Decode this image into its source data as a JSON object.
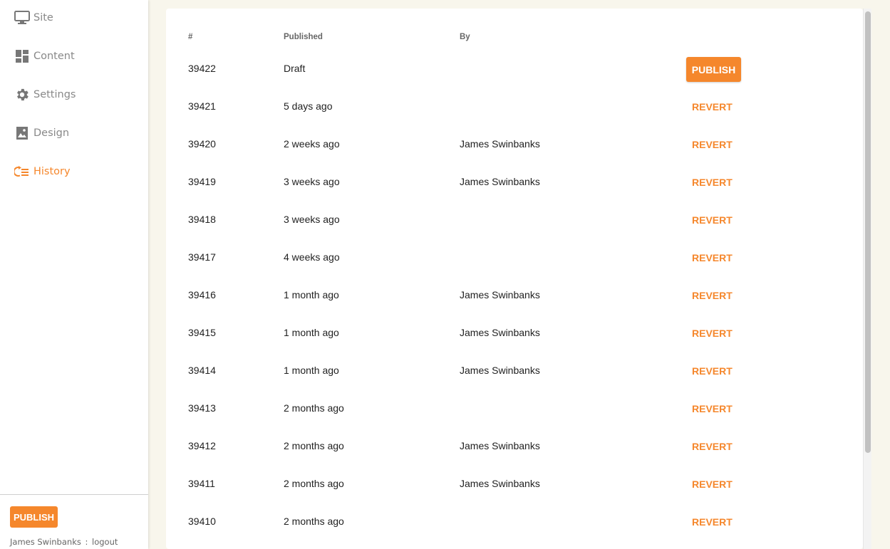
{
  "sidebar": {
    "items": [
      {
        "label": "Site",
        "icon": "monitor-icon",
        "active": false
      },
      {
        "label": "Content",
        "icon": "dashboard-icon",
        "active": false
      },
      {
        "label": "Settings",
        "icon": "gear-icon",
        "active": false
      },
      {
        "label": "Design",
        "icon": "image-icon",
        "active": false
      },
      {
        "label": "History",
        "icon": "history-icon",
        "active": true
      }
    ],
    "publish_label": "PUBLISH",
    "user_name": "James Swinbanks",
    "user_separator": ":",
    "logout_label": "logout"
  },
  "table": {
    "headers": {
      "num": "#",
      "published": "Published",
      "by": "By"
    },
    "rows": [
      {
        "num": "39422",
        "published": "Draft",
        "by": "",
        "action": "PUBLISH"
      },
      {
        "num": "39421",
        "published": "5 days ago",
        "by": "",
        "action": "REVERT"
      },
      {
        "num": "39420",
        "published": "2 weeks ago",
        "by": "James Swinbanks",
        "action": "REVERT"
      },
      {
        "num": "39419",
        "published": "3 weeks ago",
        "by": "James Swinbanks",
        "action": "REVERT"
      },
      {
        "num": "39418",
        "published": "3 weeks ago",
        "by": "",
        "action": "REVERT"
      },
      {
        "num": "39417",
        "published": "4 weeks ago",
        "by": "",
        "action": "REVERT"
      },
      {
        "num": "39416",
        "published": "1 month ago",
        "by": "James Swinbanks",
        "action": "REVERT"
      },
      {
        "num": "39415",
        "published": "1 month ago",
        "by": "James Swinbanks",
        "action": "REVERT"
      },
      {
        "num": "39414",
        "published": "1 month ago",
        "by": "James Swinbanks",
        "action": "REVERT"
      },
      {
        "num": "39413",
        "published": "2 months ago",
        "by": "",
        "action": "REVERT"
      },
      {
        "num": "39412",
        "published": "2 months ago",
        "by": "James Swinbanks",
        "action": "REVERT"
      },
      {
        "num": "39411",
        "published": "2 months ago",
        "by": "James Swinbanks",
        "action": "REVERT"
      },
      {
        "num": "39410",
        "published": "2 months ago",
        "by": "",
        "action": "REVERT"
      }
    ]
  },
  "colors": {
    "accent": "#f5872c",
    "background": "#f8f6ec",
    "muted_text": "#888888"
  }
}
